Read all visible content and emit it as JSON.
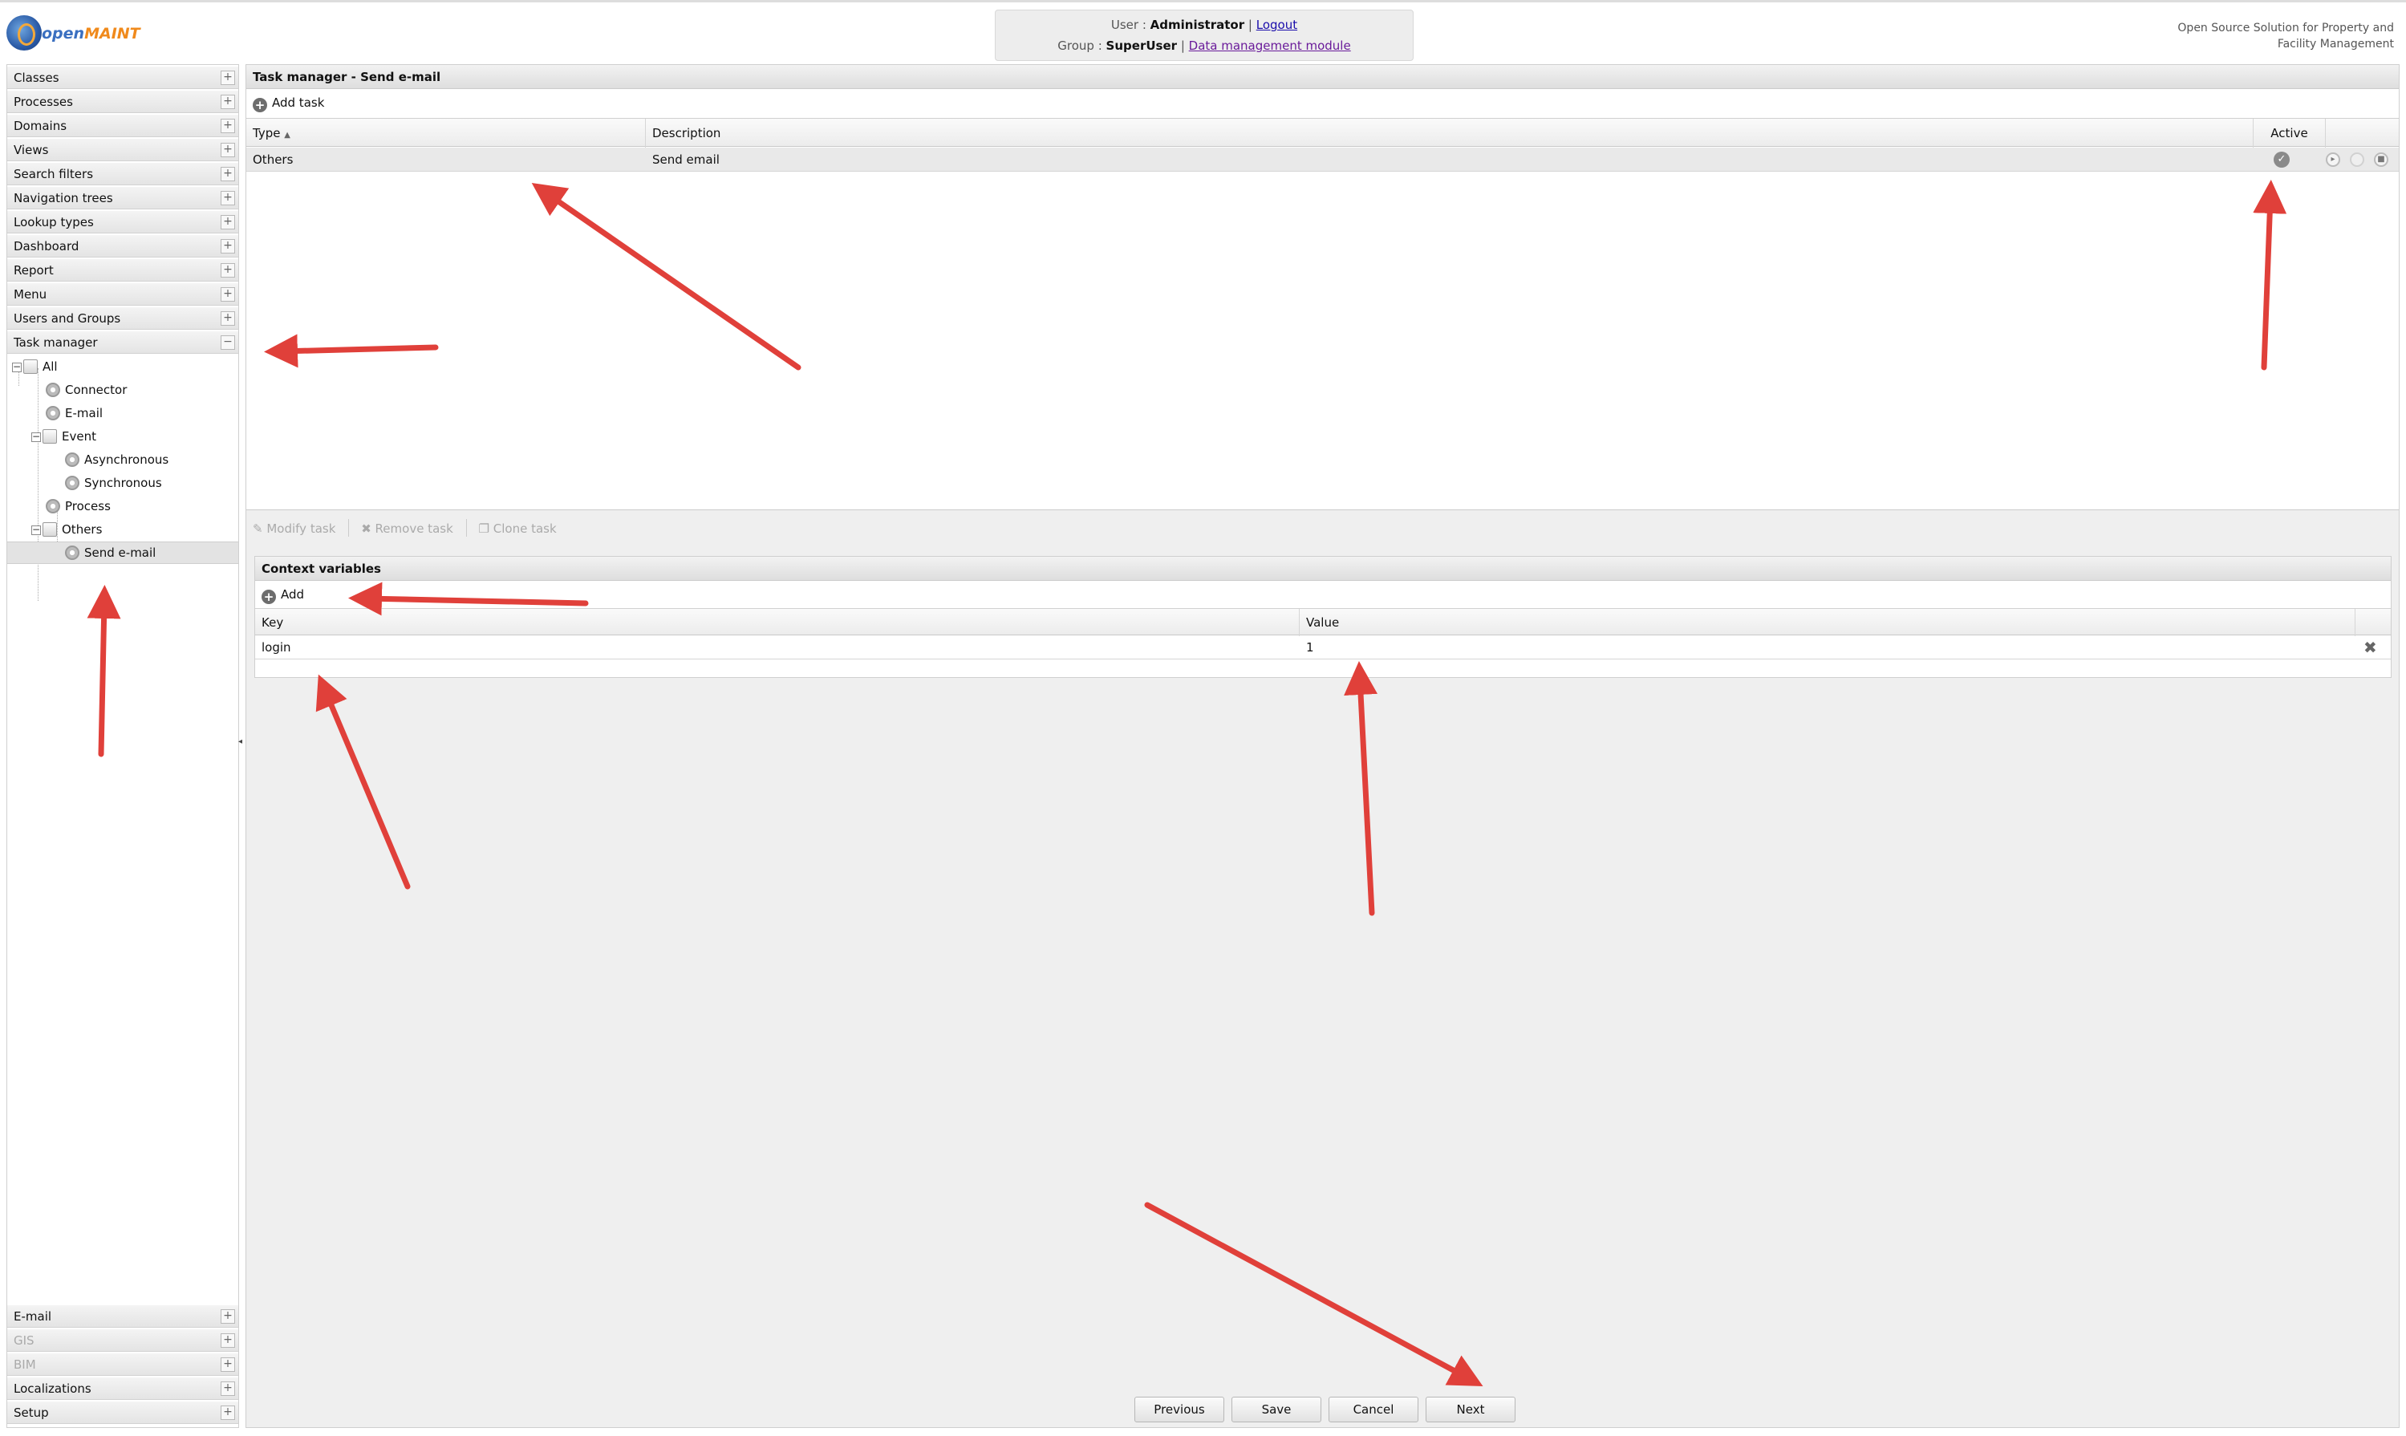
{
  "header": {
    "logo_text_1": "open",
    "logo_text_2": "MAINT",
    "user_label": "User : ",
    "user_name": "Administrator",
    "logout": "Logout",
    "group_label": "Group : ",
    "group_name": "SuperUser",
    "module_link": "Data management module",
    "separator": "|",
    "tagline_1": "Open Source Solution for Property and",
    "tagline_2": "Facility Management"
  },
  "sidebar": {
    "items": [
      {
        "label": "Classes"
      },
      {
        "label": "Processes"
      },
      {
        "label": "Domains"
      },
      {
        "label": "Views"
      },
      {
        "label": "Search filters"
      },
      {
        "label": "Navigation trees"
      },
      {
        "label": "Lookup types"
      },
      {
        "label": "Dashboard"
      },
      {
        "label": "Report"
      },
      {
        "label": "Menu"
      },
      {
        "label": "Users and Groups"
      },
      {
        "label": "Task manager"
      }
    ],
    "tree": {
      "all": "All",
      "connector": "Connector",
      "email": "E-mail",
      "event": "Event",
      "asynchronous": "Asynchronous",
      "synchronous": "Synchronous",
      "process": "Process",
      "others": "Others",
      "send_email": "Send e-mail"
    },
    "bottom_items": [
      {
        "label": "E-mail",
        "enabled": true
      },
      {
        "label": "GIS",
        "enabled": false
      },
      {
        "label": "BIM",
        "enabled": false
      },
      {
        "label": "Localizations",
        "enabled": true
      },
      {
        "label": "Setup",
        "enabled": true
      }
    ]
  },
  "tasks": {
    "title": "Task manager - Send e-mail",
    "add_task": "Add task",
    "columns": {
      "type": "Type",
      "sort": "▲",
      "description": "Description",
      "active": "Active"
    },
    "rows": [
      {
        "type": "Others",
        "description": "Send email",
        "active": true
      }
    ],
    "toolbar": {
      "modify": "Modify task",
      "remove": "Remove task",
      "clone": "Clone task"
    }
  },
  "context": {
    "title": "Context variables",
    "add": "Add",
    "columns": {
      "key": "Key",
      "value": "Value"
    },
    "rows": [
      {
        "key": "login",
        "value": "1"
      }
    ]
  },
  "footer": {
    "previous": "Previous",
    "save": "Save",
    "cancel": "Cancel",
    "next": "Next"
  },
  "colors": {
    "annotation_arrow": "#e0403a",
    "link": "#1a0dab",
    "brand_blue": "#3a6fc0",
    "brand_orange": "#f08a1c"
  }
}
